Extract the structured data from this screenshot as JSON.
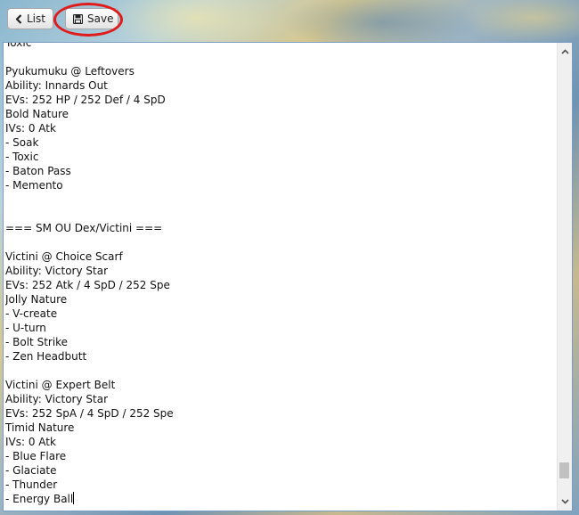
{
  "toolbar": {
    "list_label": "List",
    "save_label": "Save",
    "list_icon": "chevron-left-icon",
    "save_icon": "floppy-disk-icon",
    "highlight_color": "#e01b1b"
  },
  "editor": {
    "lines": [
      "Toxic",
      "",
      "Pyukumuku @ Leftovers",
      "Ability: Innards Out",
      "EVs: 252 HP / 252 Def / 4 SpD",
      "Bold Nature",
      "IVs: 0 Atk",
      "- Soak",
      "- Toxic",
      "- Baton Pass",
      "- Memento",
      "",
      "",
      "=== SM OU Dex/Victini ===",
      "",
      "Victini @ Choice Scarf",
      "Ability: Victory Star",
      "EVs: 252 Atk / 4 SpD / 252 Spe",
      "Jolly Nature",
      "- V-create",
      "- U-turn",
      "- Bolt Strike",
      "- Zen Headbutt",
      "",
      "Victini @ Expert Belt",
      "Ability: Victory Star",
      "EVs: 252 SpA / 4 SpD / 252 Spe",
      "Timid Nature",
      "IVs: 0 Atk",
      "- Blue Flare",
      "- Glaciate",
      "- Thunder",
      "- Energy Ball"
    ],
    "scroll_position": 0.97
  }
}
